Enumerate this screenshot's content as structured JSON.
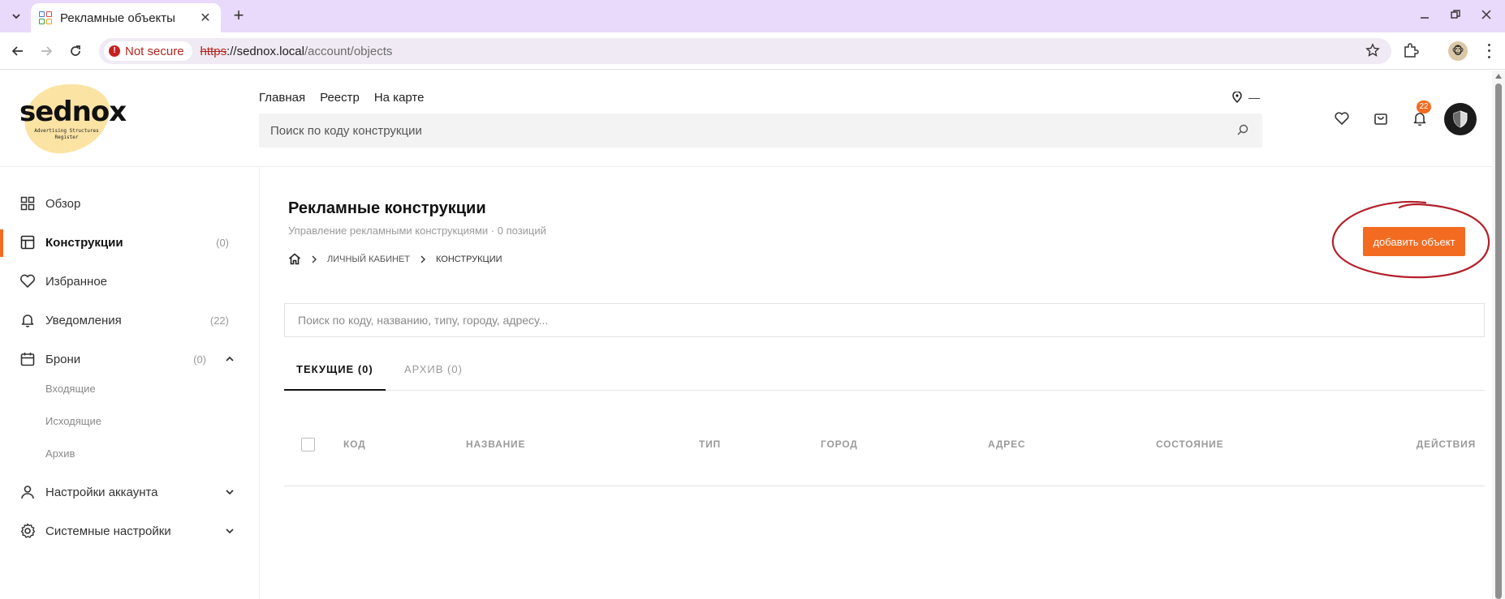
{
  "browser": {
    "tab_title": "Рекламные объекты",
    "new_tab": "+",
    "security_label": "Not secure",
    "url_protocol": "https",
    "url_host": "://sednox.local",
    "url_path": "/account/objects",
    "profile_emoji": "🐵"
  },
  "header": {
    "logo_text": "sednox",
    "logo_subtitle": "Advertising Structures Register",
    "nav": [
      "Главная",
      "Реестр",
      "На карте"
    ],
    "location_value": "—",
    "search_placeholder": "Поиск по коду конструкции",
    "notifications_count": "22"
  },
  "sidebar": {
    "items": [
      {
        "label": "Обзор",
        "count": ""
      },
      {
        "label": "Конструкции",
        "count": "(0)"
      },
      {
        "label": "Избранное",
        "count": ""
      },
      {
        "label": "Уведомления",
        "count": "(22)"
      },
      {
        "label": "Брони",
        "count": "(0)"
      },
      {
        "label": "Настройки аккаунта",
        "count": ""
      },
      {
        "label": "Системные настройки",
        "count": ""
      }
    ],
    "bookings_sub": [
      "Входящие",
      "Исходящие",
      "Архив"
    ]
  },
  "main": {
    "title": "Рекламные конструкции",
    "subtitle": "Управление рекламными конструкциями · 0 позиций",
    "breadcrumb": [
      "ЛИЧНЫЙ КАБИНЕТ",
      "КОНСТРУКЦИИ"
    ],
    "add_button": "добавить объект",
    "search_placeholder": "Поиск по коду, названию, типу, городу, адресу...",
    "tabs": [
      "ТЕКУЩИЕ (0)",
      "АРХИВ (0)"
    ],
    "columns": [
      "КОД",
      "НАЗВАНИЕ",
      "ТИП",
      "ГОРОД",
      "АДРЕС",
      "СОСТОЯНИЕ",
      "ДЕЙСТВИЯ"
    ]
  },
  "colors": {
    "accent": "#f36b21",
    "annotation_circle": "#b3202a",
    "tabbar": "#e9d9fb"
  }
}
